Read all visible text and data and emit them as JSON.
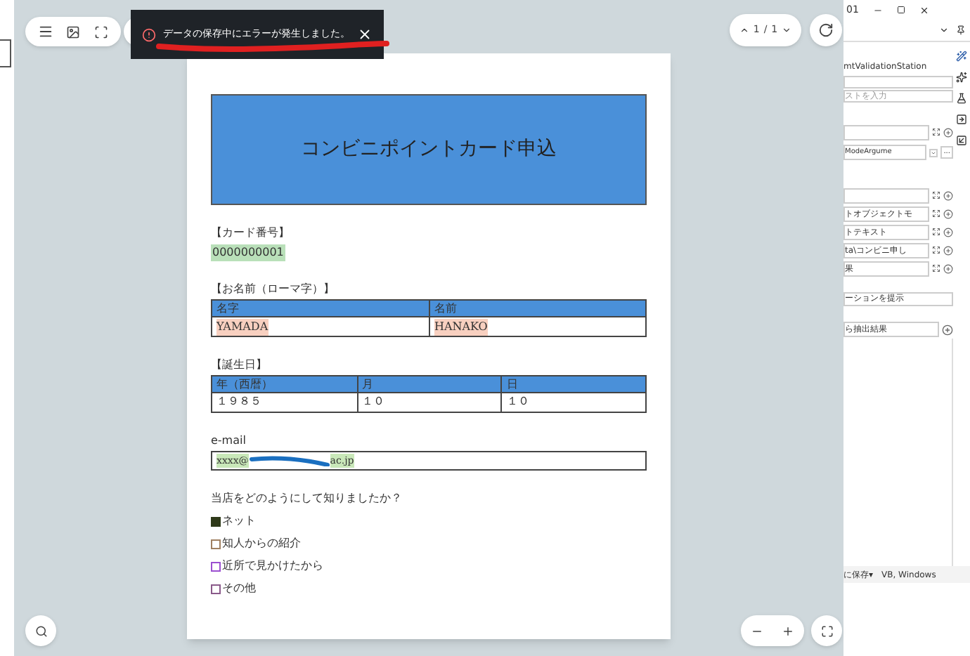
{
  "toast": {
    "message": "データの保存中にエラーが発生しました。"
  },
  "page_nav": {
    "current": "1",
    "separator": "/",
    "total": "1"
  },
  "document": {
    "title": "コンビニポイントカード申込",
    "card_number": {
      "label": "【カード番号】",
      "value": "0000000001"
    },
    "name": {
      "label": "【お名前（ローマ字）】",
      "columns": [
        "名字",
        "名前"
      ],
      "values": [
        "YAMADA",
        "HANAKO"
      ]
    },
    "birthday": {
      "label": "【誕生日】",
      "columns": [
        "年（西暦）",
        "月",
        "日"
      ],
      "values": [
        "１９８５",
        "１０",
        "１０"
      ]
    },
    "email": {
      "label": "e-mail",
      "value_start": "xxxx@",
      "value_end": "ac.jp"
    },
    "survey": {
      "question": "当店をどのようにして知りましたか？",
      "options": [
        {
          "label": "ネット",
          "checked": true,
          "color": "#2f3a1a"
        },
        {
          "label": "知人からの紹介",
          "checked": false,
          "color": "#a08060"
        },
        {
          "label": "近所で見かけたから",
          "checked": false,
          "color": "#9b4fd0"
        },
        {
          "label": "その他",
          "checked": false,
          "color": "#8a5a8a"
        }
      ]
    }
  },
  "side_panel": {
    "title": "01",
    "heading": "mtValidationStation",
    "search": {
      "placeholder": "ストを入力"
    },
    "argument": "ModeArgume",
    "more": "...",
    "rows": [
      "トオブジェクトモ",
      "トテキスト",
      "ta\\コンビニ申し",
      "果"
    ],
    "hint": "ーションを提示",
    "result": "ら抽出結果",
    "save": "に保存",
    "save_caret": "▾",
    "platform": "VB, Windows"
  }
}
